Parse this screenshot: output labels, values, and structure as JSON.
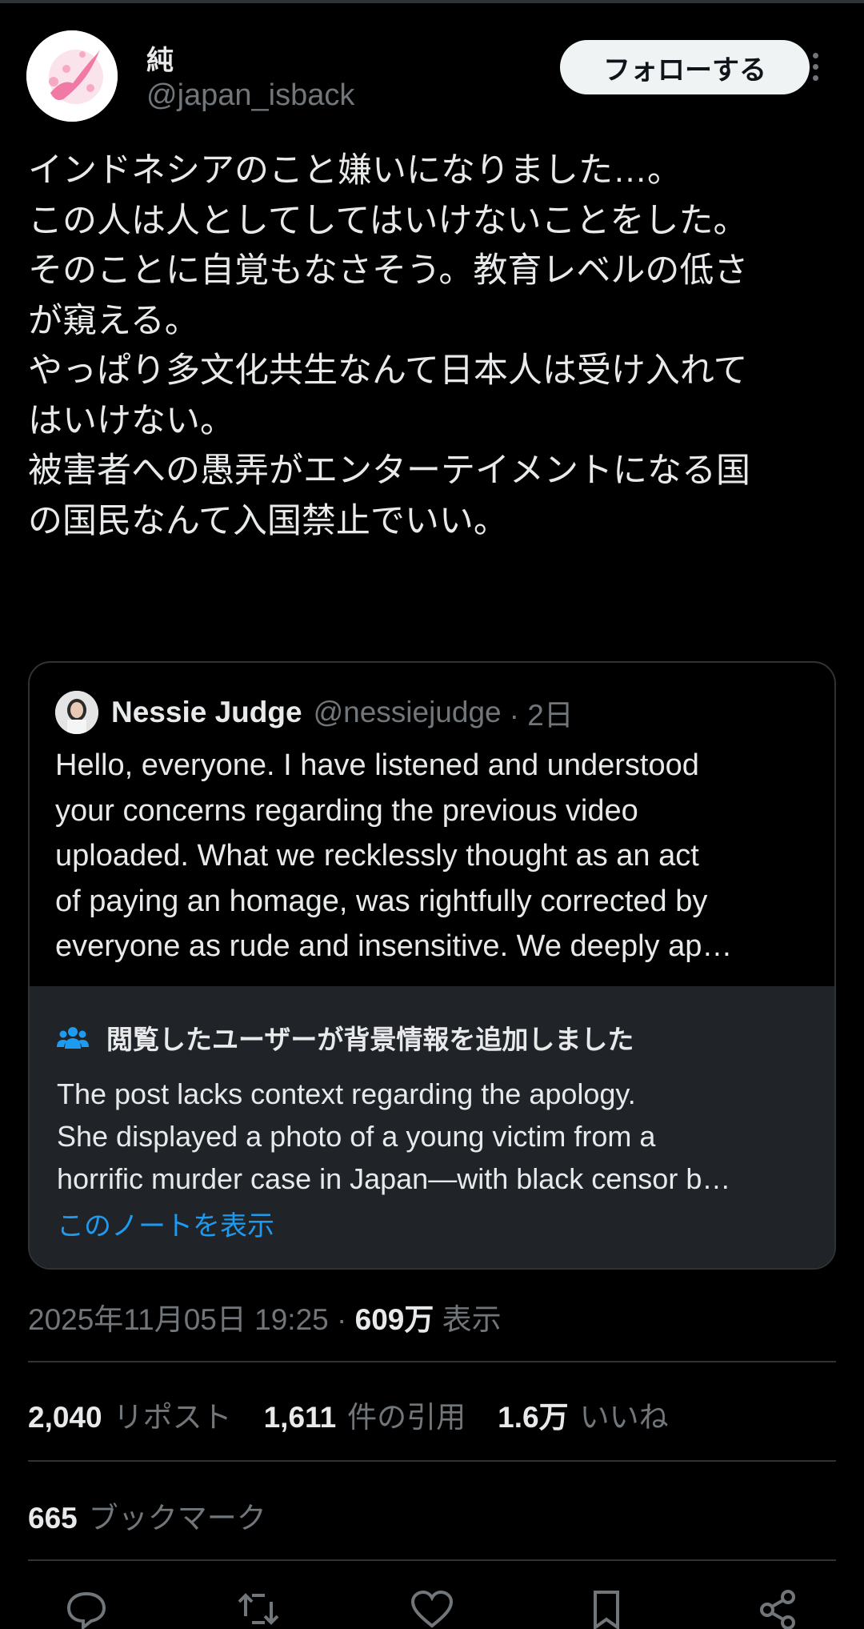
{
  "author": {
    "name": "純",
    "handle": "@japan_isback"
  },
  "follow_button": "フォローする",
  "tweet_lines": [
    "インドネシアのこと嫌いになりました…。",
    "この人は人としてしてはいけないことをした。",
    "そのことに自覚もなさそう。教育レベルの低さ",
    "が窺える。",
    "やっぱり多文化共生なんて日本人は受け入れて",
    "はいけない。",
    "被害者への愚弄がエンターテイメントになる国",
    "の国民なんて入国禁止でいい。"
  ],
  "quoted": {
    "name": "Nessie Judge",
    "handle": "@nessiejudge",
    "time": "· 2日",
    "lines": [
      "Hello, everyone. I have listened and understood",
      "your concerns regarding the previous video",
      "uploaded. What we recklessly thought as an act",
      "of paying an homage, was rightfully corrected by",
      "everyone as rude and insensitive. We deeply ap…"
    ]
  },
  "note": {
    "title": "閲覧したユーザーが背景情報を追加しました",
    "lines": [
      "The post lacks context regarding the apology.",
      "She displayed a photo of a young victim from a",
      "horrific murder case in Japan—with black censor b…"
    ],
    "link": "このノートを表示"
  },
  "meta": {
    "datetime": "2025年11月05日 19:25 · ",
    "views_num": "609万",
    "views_label": " 表示"
  },
  "stats": {
    "reposts_num": "2,040",
    "reposts_label": "リポスト",
    "quotes_num": "1,611",
    "quotes_label": "件の引用",
    "likes_num": "1.6万",
    "likes_label": "いいね"
  },
  "bookmarks": {
    "num": "665",
    "label": "ブックマーク"
  },
  "icons": [
    "reply-icon",
    "repost-icon",
    "like-icon",
    "bookmark-icon",
    "share-icon"
  ],
  "colors": {
    "background": "#000000",
    "text": "#e7e9ea",
    "muted": "#71767b",
    "link": "#1d9bf0",
    "note_bg": "#202327"
  }
}
